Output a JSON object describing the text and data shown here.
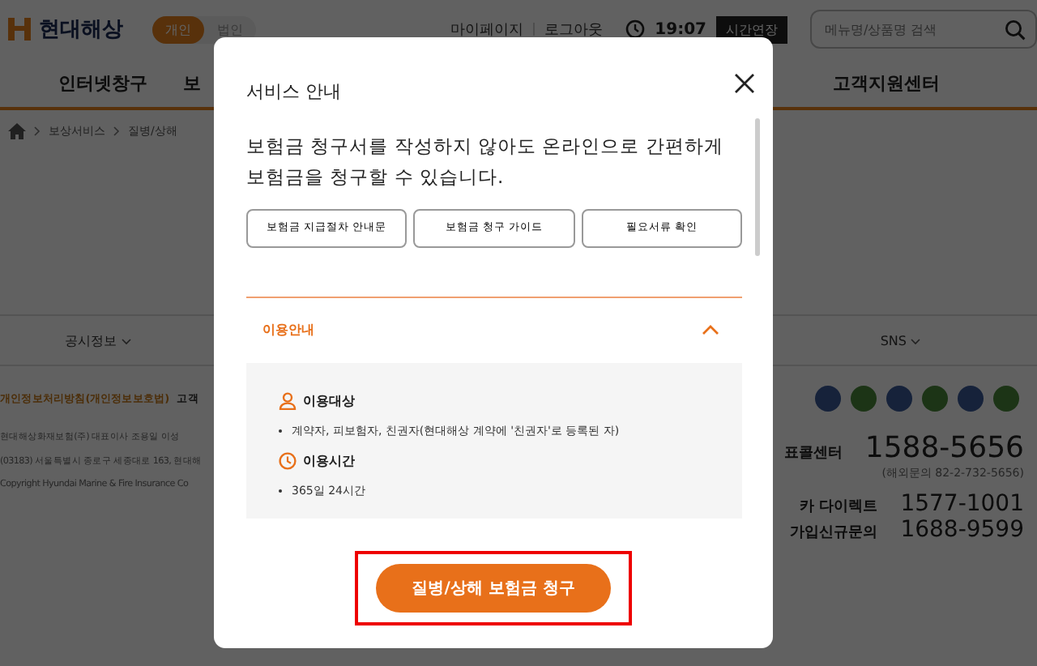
{
  "header": {
    "logo": "현대해상",
    "segments": [
      {
        "label": "개인",
        "selected": true
      },
      {
        "label": "법인",
        "selected": false
      }
    ],
    "links": [
      "마이페이지",
      "로그아웃"
    ],
    "time": "19:07",
    "extend_button": "시간연장",
    "search": {
      "placeholder": "메뉴명/상품명 검색"
    }
  },
  "nav": [
    "인터넷창구",
    "보",
    "고객지원센터"
  ],
  "breadcrumb": [
    "보상서비스",
    "질병/상해"
  ],
  "footer_bar": [
    "공시정보",
    "SNS"
  ],
  "footer_links": [
    "개인정보처리방침(개인정보보호법)",
    "고객"
  ],
  "company_lines": [
    "현대해상화재보험(주)   대표이사 조용일 이성",
    "(03183) 서울특별시 종로구 세종대로 163, 현대해",
    "Copyright Hyundai Marine & Fire Insurance Co"
  ],
  "contacts": [
    {
      "label": "표콜센터",
      "number": "1588-5656",
      "note": "(해외문의 82-2-732-5656)"
    },
    {
      "label": "카 다이렉트",
      "number": "1577-1001"
    },
    {
      "label": "가입신규문의",
      "number": "1688-9599"
    }
  ],
  "modal": {
    "title": "서비스 안내",
    "intro": "보험금 청구서를 작성하지 않아도 온라인으로 간편하게\n보험금을 청구할 수 있습니다.",
    "buttons": [
      "보험금 지급절차 안내문",
      "보험금 청구 가이드",
      "필요서류 확인"
    ],
    "accordion": {
      "title": "이용안내",
      "expanded": true,
      "sections": [
        {
          "kind": "person",
          "heading": "이용대상",
          "items": [
            "계약자, 피보험자, 친권자(현대해상 계약에 '친권자'로 등록된 자)"
          ]
        },
        {
          "kind": "clock",
          "heading": "이용시간",
          "items": [
            "365일 24시간"
          ]
        }
      ]
    },
    "primary_button": "질병/상해 보험금 청구",
    "highlighted": true
  }
}
